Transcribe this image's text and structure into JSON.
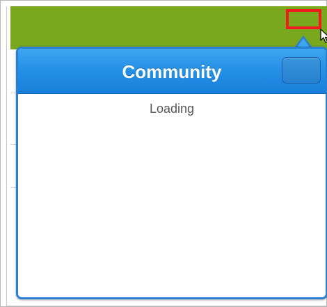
{
  "popover": {
    "title": "Community",
    "status_text": "Loading"
  },
  "colors": {
    "topbar": "#79a71d",
    "highlight": "#ee1c1c",
    "popover_header": "#2390e6",
    "popover_border": "#2b7fd0"
  },
  "icons": {
    "cursor": "mouse-pointer-icon"
  }
}
